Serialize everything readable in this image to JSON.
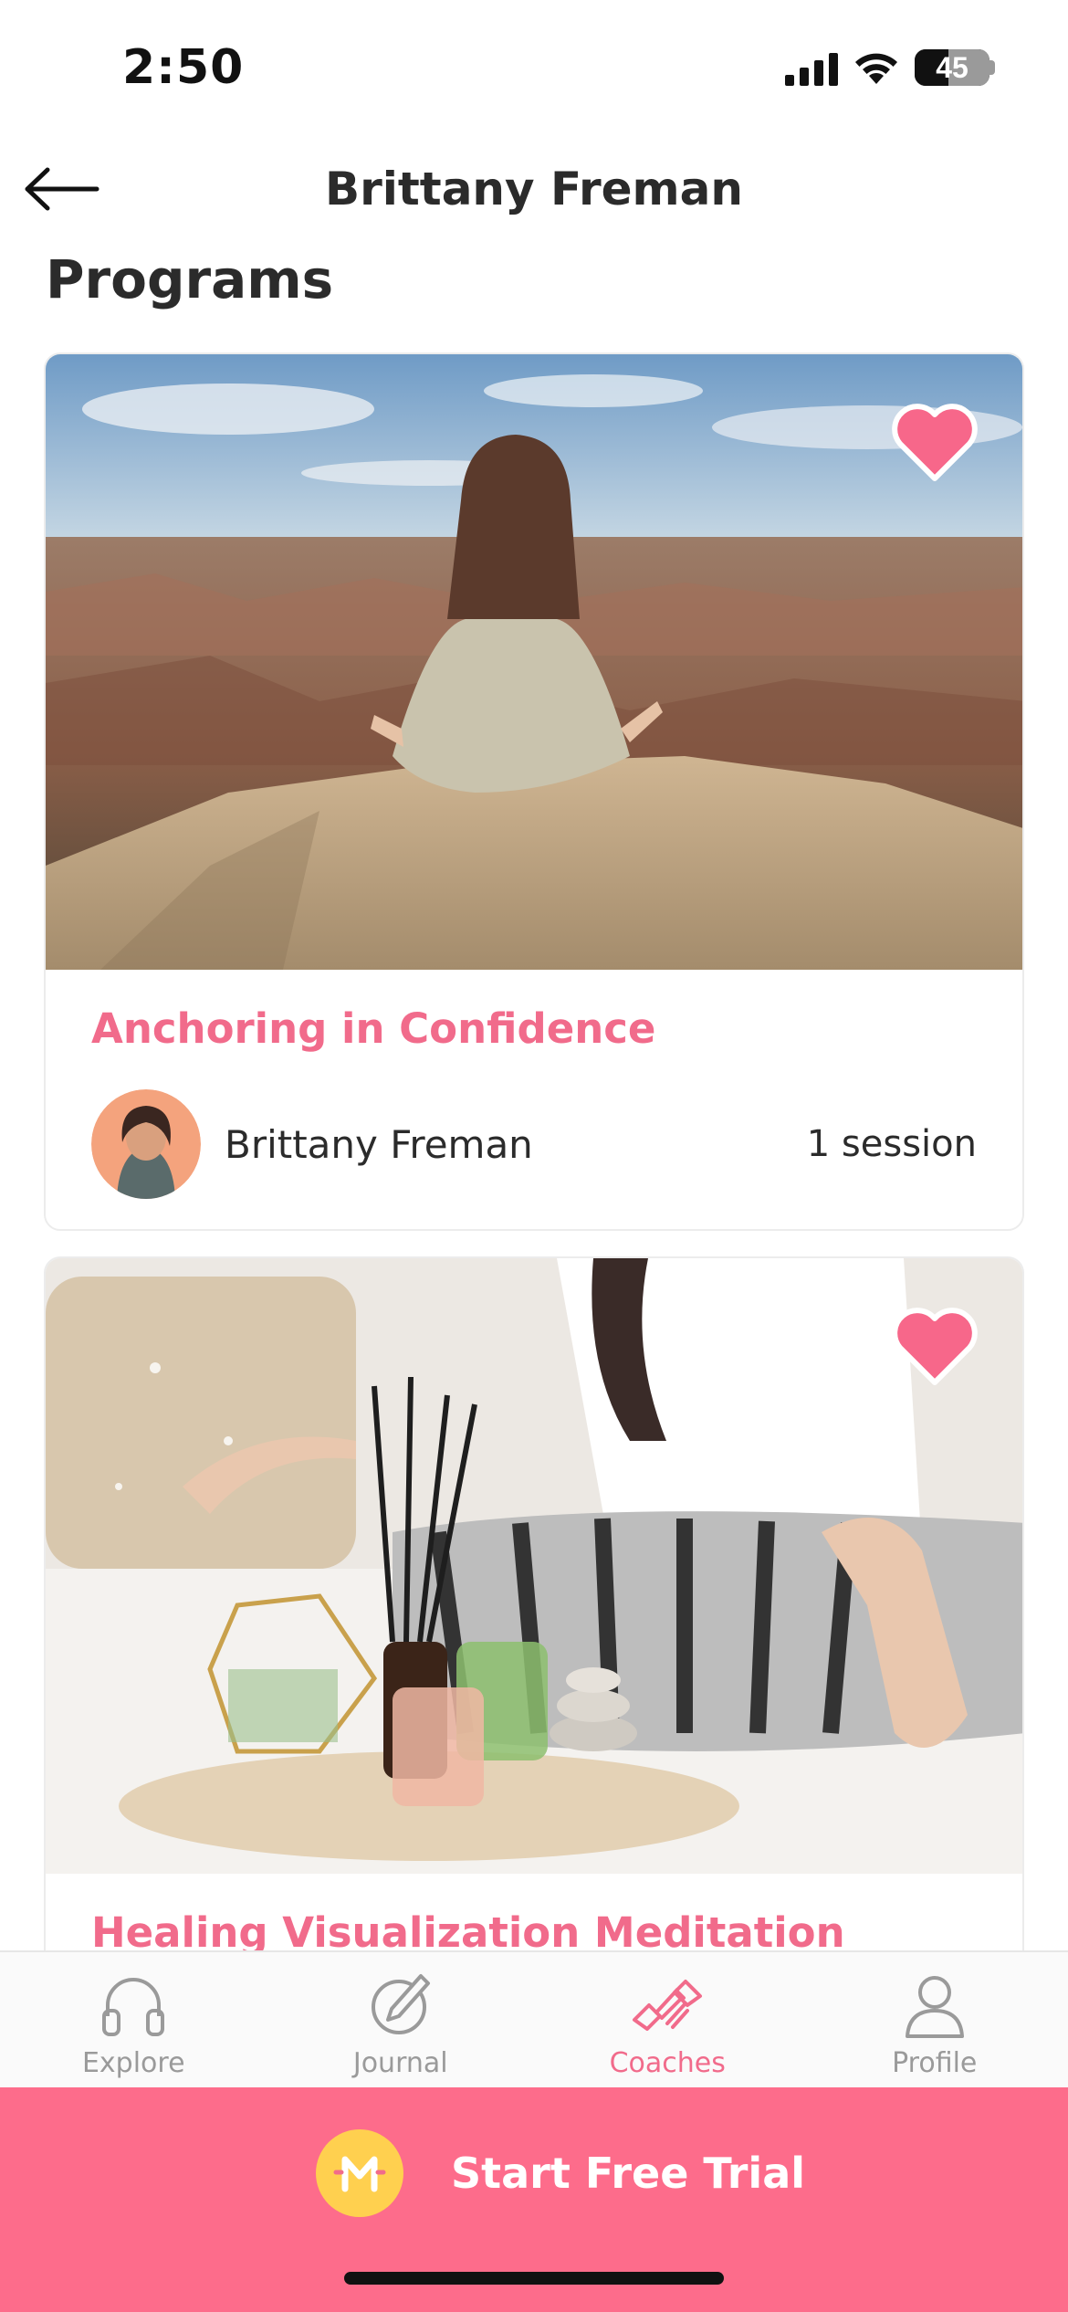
{
  "status_bar": {
    "time": "2:50",
    "battery": "45"
  },
  "header": {
    "title": "Brittany Freman"
  },
  "section": {
    "title": "Programs"
  },
  "programs": [
    {
      "title": "Anchoring in Confidence",
      "coach": "Brittany Freman",
      "sessions": "1 session",
      "favorited": true
    },
    {
      "title": "Healing Visualization Meditation",
      "favorited": true
    }
  ],
  "tabs": [
    {
      "label": "Explore",
      "icon": "headphones-icon",
      "active": false
    },
    {
      "label": "Journal",
      "icon": "pen-circle-icon",
      "active": false
    },
    {
      "label": "Coaches",
      "icon": "handshake-icon",
      "active": true
    },
    {
      "label": "Profile",
      "icon": "person-icon",
      "active": false
    }
  ],
  "cta": {
    "label": "Start Free Trial",
    "logo_letter": "M"
  },
  "colors": {
    "accent": "#fd6c8b",
    "title_pink": "#f16b8b",
    "logo_yellow": "#ffd04f"
  }
}
